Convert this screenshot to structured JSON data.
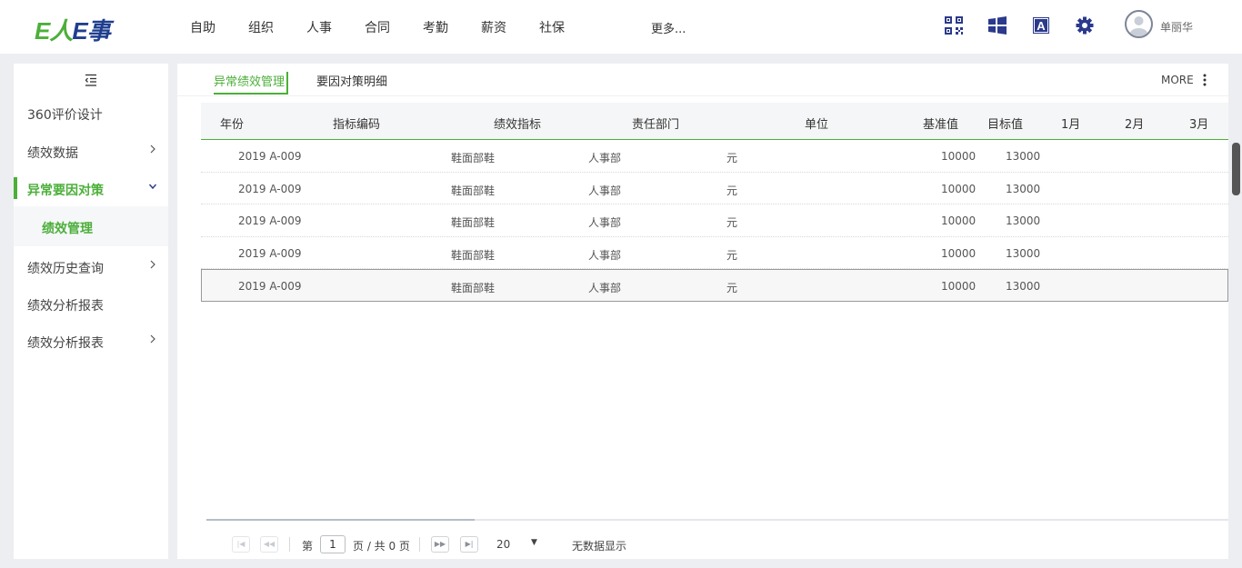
{
  "logo": {
    "e1": "E",
    "ren": "人",
    "e2": "E",
    "shi": "事"
  },
  "nav": [
    "自助",
    "组织",
    "人事",
    "合同",
    "考勤",
    "薪资",
    "社保"
  ],
  "nav_more": "更多...",
  "user": {
    "name": "单丽华"
  },
  "icons": [
    "qrcode-icon",
    "windows-icon",
    "font-icon",
    "gear-icon",
    "avatar-icon",
    "collapse-menu-icon",
    "kebab-icon"
  ],
  "sidebar": {
    "items": [
      {
        "label": "360评价设计",
        "arrow": ""
      },
      {
        "label": "绩效数据",
        "arrow": "right"
      },
      {
        "label": "异常要因对策",
        "arrow": "down"
      },
      {
        "label": "绩效管理",
        "arrow": ""
      },
      {
        "label": "绩效历史查询",
        "arrow": "right"
      },
      {
        "label": "绩效分析报表",
        "arrow": ""
      },
      {
        "label": "绩效分析报表",
        "arrow": "right"
      }
    ]
  },
  "tabs": [
    "异常绩效管理",
    "要因对策明细"
  ],
  "more_label": "MORE",
  "table": {
    "headers": [
      "年份",
      "指标编码",
      "绩效指标",
      "责任部门",
      "单位",
      "基准值",
      "目标值",
      "1月",
      "2月",
      "3月"
    ],
    "rows": [
      [
        "2019 A-009",
        "鞋面部鞋",
        "人事部",
        "元",
        "10000",
        "13000"
      ],
      [
        "2019 A-009",
        "鞋面部鞋",
        "人事部",
        "元",
        "10000",
        "13000"
      ],
      [
        "2019 A-009",
        "鞋面部鞋",
        "人事部",
        "元",
        "10000",
        "13000"
      ],
      [
        "2019 A-009",
        "鞋面部鞋",
        "人事部",
        "元",
        "10000",
        "13000"
      ],
      [
        "2019 A-009",
        "鞋面部鞋",
        "人事部",
        "元",
        "10000",
        "13000"
      ]
    ]
  },
  "pager": {
    "page_prefix": "第",
    "page_value": "1",
    "page_suffix": "页 / 共 0 页",
    "page_size": "20",
    "empty_text": "无数据显示"
  },
  "colors": {
    "accent": "#4caf3a",
    "brand_blue": "#1f3e8f",
    "icon_blue": "#2b3a8c"
  }
}
